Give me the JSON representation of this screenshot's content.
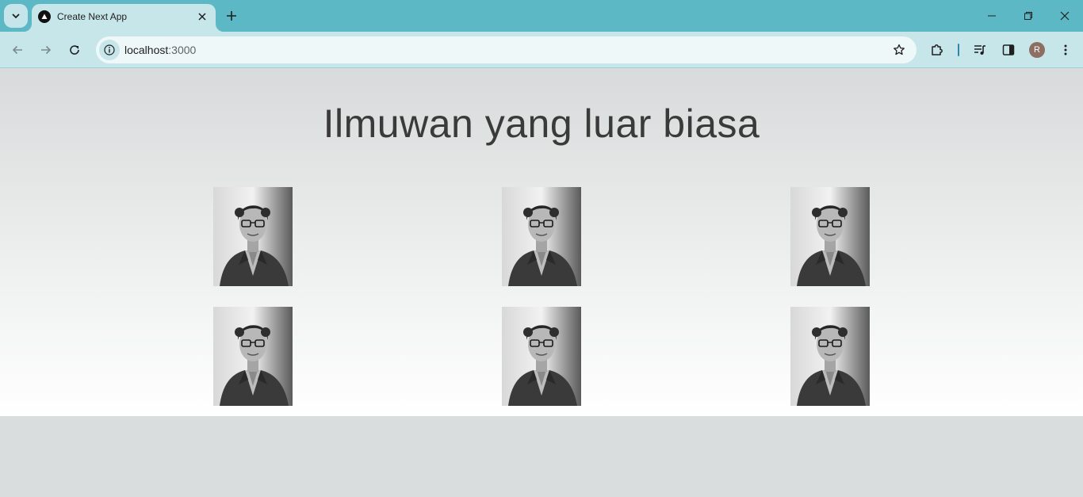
{
  "browser": {
    "tab": {
      "title": "Create Next App"
    },
    "address": {
      "host": "localhost",
      "port": ":3000"
    },
    "profile_initial": "R"
  },
  "page": {
    "heading": "Ilmuwan yang luar biasa",
    "gallery": [
      {
        "subject": "portrait-photo"
      },
      {
        "subject": "portrait-photo"
      },
      {
        "subject": "portrait-photo"
      },
      {
        "subject": "portrait-photo"
      },
      {
        "subject": "portrait-photo"
      },
      {
        "subject": "portrait-photo"
      }
    ]
  },
  "colors": {
    "frame": "#5bb8c4",
    "toolbar": "#c7e6ea",
    "omnibox": "#eef8f9",
    "heading_text": "#3a3a3a"
  }
}
